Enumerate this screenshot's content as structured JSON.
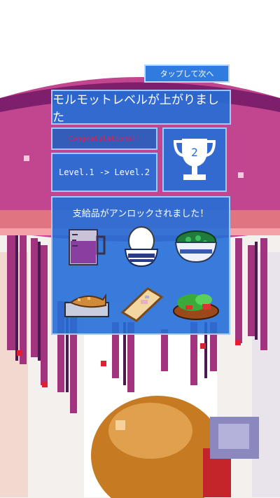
{
  "tap_button": {
    "label": "タップして次へ"
  },
  "title": "モルモットレベルが上がりました",
  "congrats": "Congratulations!!",
  "level_text": "Level.1 -> Level.2",
  "trophy": {
    "number": "2",
    "icon": "trophy-icon"
  },
  "unlock": {
    "title": "支給品がアンロックされました！",
    "items": [
      {
        "icon": "measuring-cup-icon"
      },
      {
        "icon": "rice-bowl-icon"
      },
      {
        "icon": "seaweed-bowl-icon"
      },
      {
        "icon": "grilled-fish-icon"
      },
      {
        "icon": "bread-slice-icon"
      },
      {
        "icon": "salad-plate-icon"
      }
    ]
  },
  "colors": {
    "panel": "#236ed7",
    "panel_border": "#9fc8ff",
    "congrats_text": "#e0224a",
    "jellyfish": "#c2458f",
    "jellyfish_dark": "#7d1f6a"
  }
}
